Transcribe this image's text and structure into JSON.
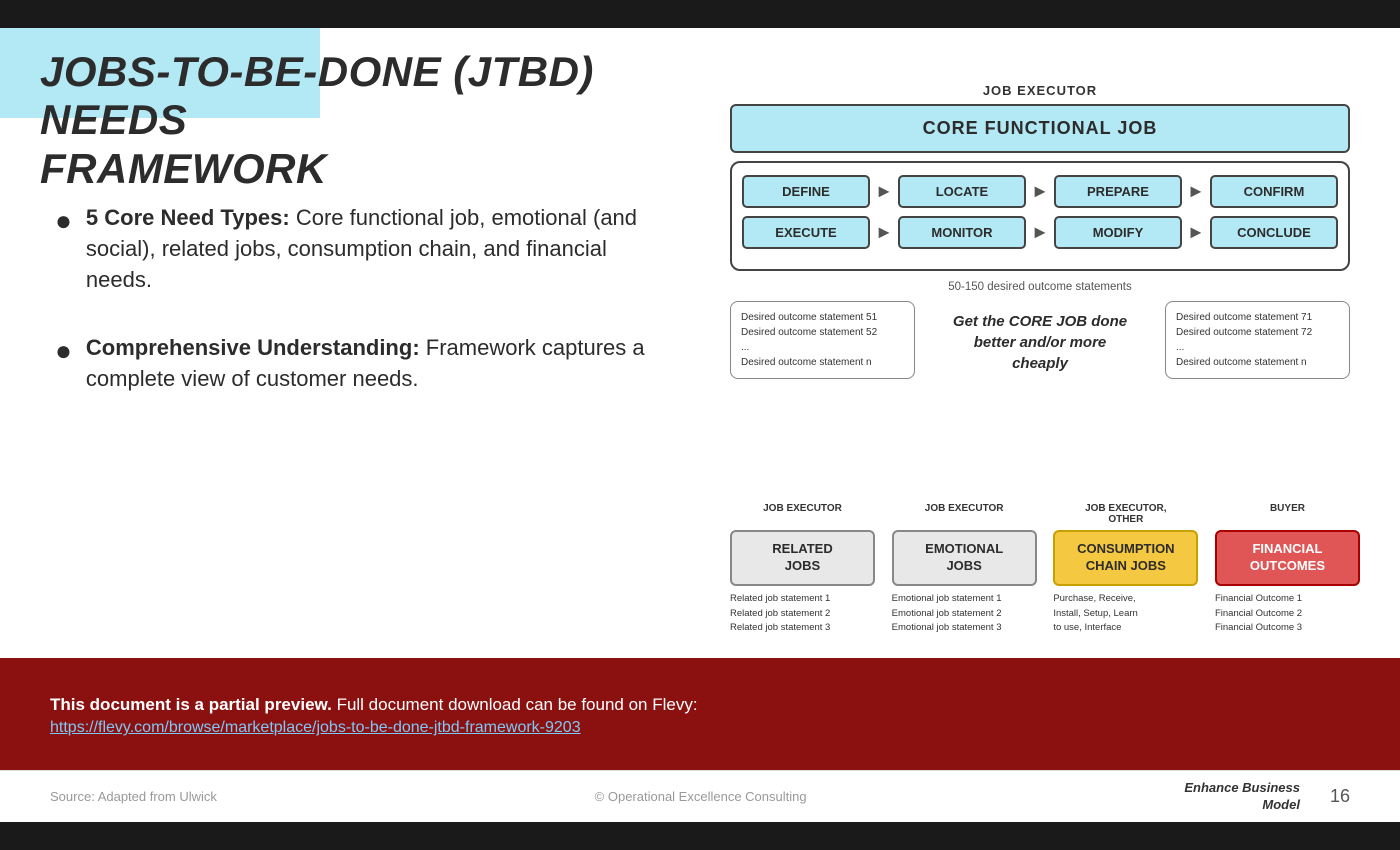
{
  "topBar": {},
  "bottomBar": {},
  "title": {
    "line1": "JOBS-TO-BE-DONE (JTBD) NEEDS",
    "line2": "FRAMEWORK"
  },
  "bullets": [
    {
      "boldText": "5 Core Need Types:",
      "normalText": " Core functional job, emotional (and social), related jobs, consumption chain, and financial needs."
    },
    {
      "boldText": "Comprehensive Understanding:",
      "normalText": " Framework captures a complete view of customer needs."
    }
  ],
  "diagram": {
    "jobExecutorLabel": "JOB EXECUTOR",
    "coreFunctionalJob": "CORE FUNCTIONAL JOB",
    "stepsRow1": [
      "DEFINE",
      "LOCATE",
      "PREPARE",
      "CONFIRM"
    ],
    "stepsRow2": [
      "EXECUTE",
      "MONITOR",
      "MODIFY",
      "CONCLUDE"
    ],
    "outcomeStatements": "50-150 desired outcome statements",
    "leftOutcomeBox": {
      "lines": [
        "Desired outcome statement 51",
        "Desired outcome statement 52",
        "...",
        "Desired outcome statement n"
      ]
    },
    "middleText": "Get the CORE JOB done better and/or more cheaply",
    "rightOutcomeBox": {
      "lines": [
        "Desired outcome statement 71",
        "Desired outcome statement 72",
        "...",
        "Desired outcome statement n"
      ]
    },
    "bottomSection": {
      "columns": [
        {
          "label": "JOB EXECUTOR",
          "boxLabel": "RELATED\nJOBS",
          "boxStyle": "grey",
          "statements": [
            "Related job statement 1",
            "Related job statement 2",
            "Related job statement 3"
          ]
        },
        {
          "label": "JOB EXECUTOR",
          "boxLabel": "EMOTIONAL\nJOBS",
          "boxStyle": "grey",
          "statements": [
            "Emotional job statement 1",
            "Emotional job statement 2",
            "Emotional job statement 3"
          ]
        },
        {
          "label": "JOB EXECUTOR,\nOTHER",
          "boxLabel": "CONSUMPTION\nCHAIN JOBS",
          "boxStyle": "orange",
          "statements": [
            "Purchase, Receive,",
            "Install, Setup, Learn",
            "to use, Interface"
          ]
        },
        {
          "label": "BUYER",
          "boxLabel": "FINANCIAL\nOUTCOMES",
          "boxStyle": "red",
          "statements": [
            "Financial Outcome 1",
            "Financial Outcome 2",
            "Financial Outcome 3"
          ]
        }
      ]
    }
  },
  "previewBanner": {
    "boldText": "This document is a partial preview.",
    "normalText": " Full document download can be found on Flevy:",
    "linkText": "https://flevy.com/browse/marketplace/jobs-to-be-done-jtbd-framework-9203"
  },
  "footer": {
    "source": "Source: Adapted from Ulwick",
    "copyright": "© Operational Excellence Consulting",
    "enhance": "Enhance Business\nModel",
    "pageNumber": "16"
  }
}
